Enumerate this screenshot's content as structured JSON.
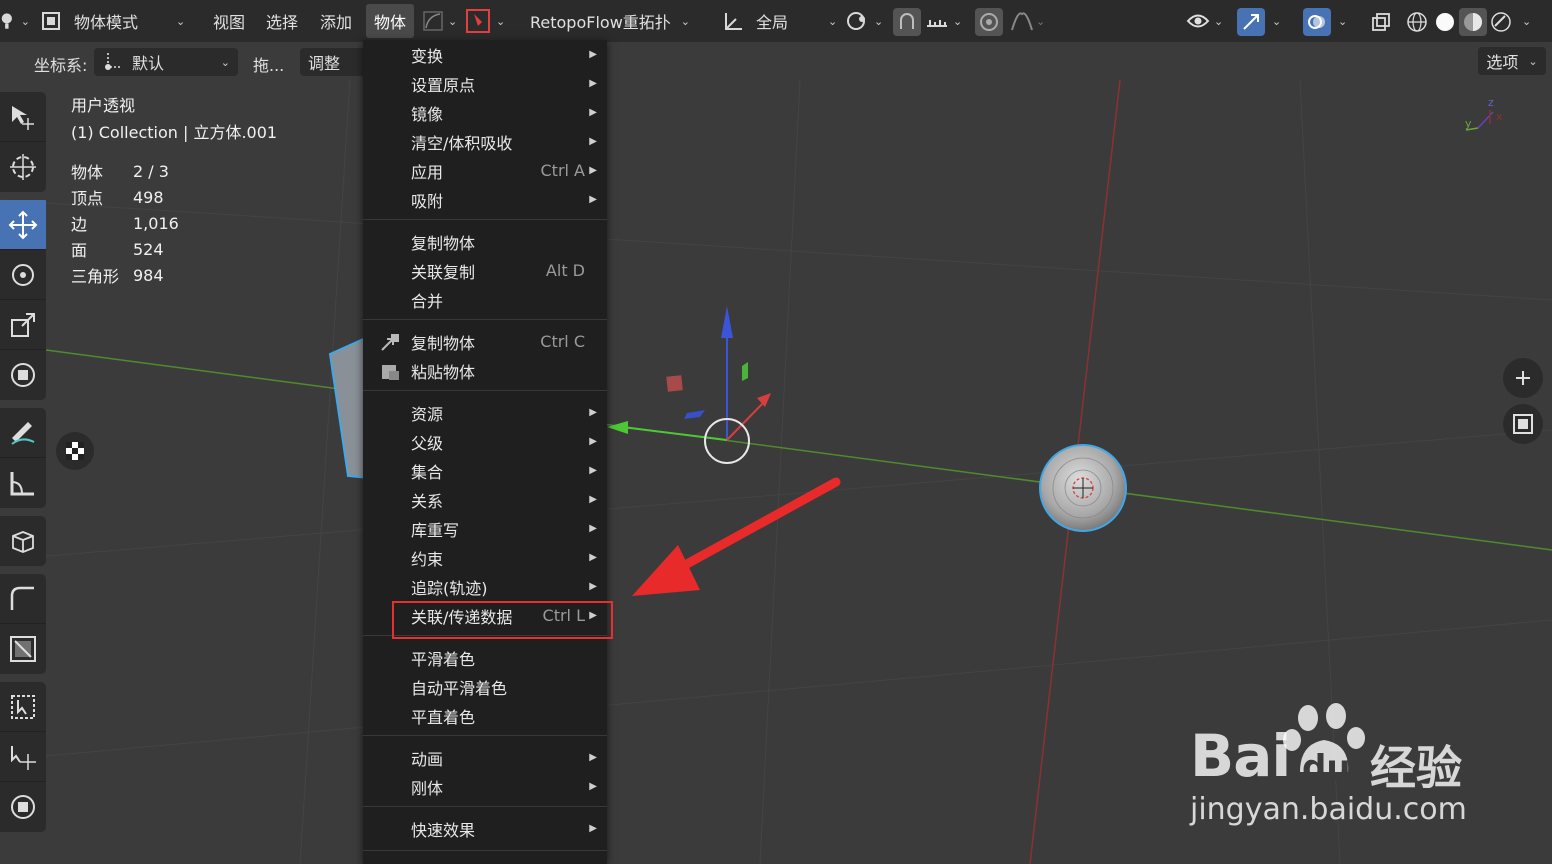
{
  "header": {
    "mode_label": "物体模式",
    "menus": [
      "视图",
      "选择",
      "添加",
      "物体"
    ],
    "addon_label": "RetopoFlow重拓扑",
    "orientation_label": "全局"
  },
  "subbar": {
    "coord_label": "坐标系:",
    "coord_value": "默认",
    "drag_label": "拖...",
    "adjust_label": "调整",
    "options_label": "选项"
  },
  "overlay": {
    "view_name": "用户透视",
    "collection": "(1) Collection | 立方体.001",
    "stats": [
      {
        "k": "物体",
        "v": "2 / 3"
      },
      {
        "k": "顶点",
        "v": "498"
      },
      {
        "k": "边",
        "v": "1,016"
      },
      {
        "k": "面",
        "v": "524"
      },
      {
        "k": "三角形",
        "v": "984"
      }
    ]
  },
  "menu": {
    "items": [
      {
        "label": "变换",
        "shortcut": "",
        "submenu": true
      },
      {
        "label": "设置原点",
        "shortcut": "",
        "submenu": true
      },
      {
        "label": "镜像",
        "shortcut": "",
        "submenu": true
      },
      {
        "label": "清空/体积吸收",
        "shortcut": "",
        "submenu": true
      },
      {
        "label": "应用",
        "shortcut": "Ctrl A",
        "submenu": true
      },
      {
        "label": "吸附",
        "shortcut": "",
        "submenu": true
      },
      {
        "label": "复制物体",
        "shortcut": "",
        "submenu": false
      },
      {
        "label": "关联复制",
        "shortcut": "Alt D",
        "submenu": false
      },
      {
        "label": "合并",
        "shortcut": "",
        "submenu": false
      },
      {
        "label": "复制物体",
        "shortcut": "Ctrl C",
        "submenu": false
      },
      {
        "label": "粘贴物体",
        "shortcut": "",
        "submenu": false
      },
      {
        "label": "资源",
        "shortcut": "",
        "submenu": true
      },
      {
        "label": "父级",
        "shortcut": "",
        "submenu": true
      },
      {
        "label": "集合",
        "shortcut": "",
        "submenu": true
      },
      {
        "label": "关系",
        "shortcut": "",
        "submenu": true
      },
      {
        "label": "库重写",
        "shortcut": "",
        "submenu": true
      },
      {
        "label": "约束",
        "shortcut": "",
        "submenu": true
      },
      {
        "label": "追踪(轨迹)",
        "shortcut": "",
        "submenu": true
      },
      {
        "label": "关联/传递数据",
        "shortcut": "Ctrl L",
        "submenu": true
      },
      {
        "label": "平滑着色",
        "shortcut": "",
        "submenu": false
      },
      {
        "label": "自动平滑着色",
        "shortcut": "",
        "submenu": false
      },
      {
        "label": "平直着色",
        "shortcut": "",
        "submenu": false
      },
      {
        "label": "动画",
        "shortcut": "",
        "submenu": true
      },
      {
        "label": "刚体",
        "shortcut": "",
        "submenu": true
      },
      {
        "label": "快速效果",
        "shortcut": "",
        "submenu": true
      }
    ],
    "arrow_glyph": "▶"
  },
  "watermark": {
    "brand": "Bai",
    "brand_du": "du",
    "brand_cn": "经验",
    "url": "jingyan.baidu.com"
  },
  "colors": {
    "accent": "#4772b3",
    "highlight": "#e53030",
    "arrow": "#e82a2a"
  }
}
